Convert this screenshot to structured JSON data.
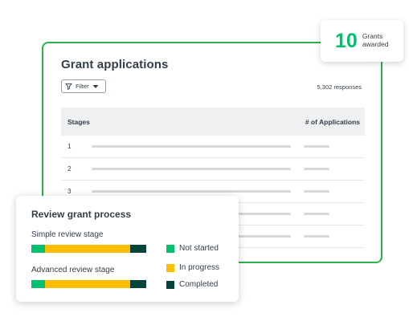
{
  "main": {
    "title": "Grant applications",
    "filter_label": "Filter",
    "responses": "5,302 responses",
    "table": {
      "headers": [
        "Stages",
        "# of Applications"
      ],
      "rows": [
        "1",
        "2",
        "3",
        "",
        ""
      ]
    }
  },
  "badge": {
    "number": "10",
    "label_line1": "Grants",
    "label_line2": "awarded"
  },
  "review": {
    "title": "Review grant process",
    "stages": [
      {
        "label": "Simple review stage",
        "not_started": 0.12,
        "in_progress": 0.74,
        "completed": 0.14
      },
      {
        "label": "Advanced review stage",
        "not_started": 0.12,
        "in_progress": 0.74,
        "completed": 0.14
      }
    ],
    "legend": [
      {
        "label": "Not started",
        "color": "#00bf6f"
      },
      {
        "label": "In progress",
        "color": "#f9be00"
      },
      {
        "label": "Completed",
        "color": "#05443c"
      }
    ]
  },
  "colors": {
    "accent_border": "#2bb24c",
    "badge_number": "#00bf6f"
  },
  "icons": [
    "filter-icon",
    "caret-down-icon"
  ]
}
